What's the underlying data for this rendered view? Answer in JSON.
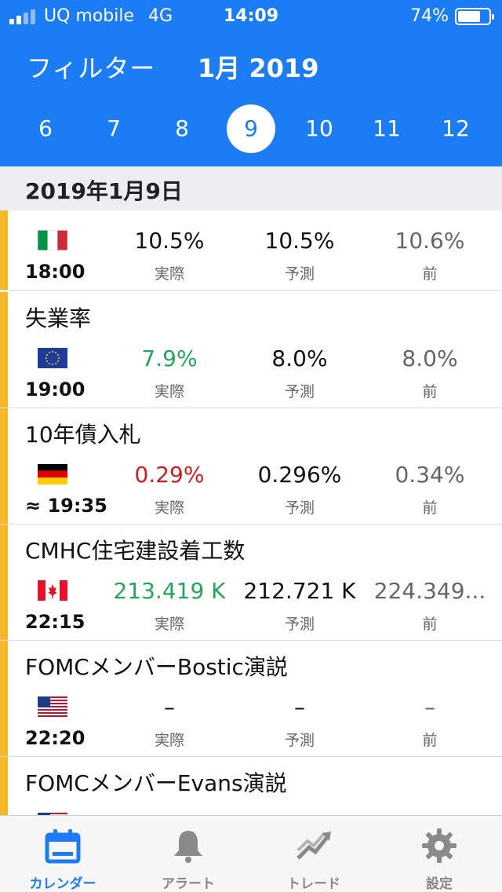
{
  "status_bar": {
    "carrier": "UQ mobile",
    "network": "4G",
    "time": "14:09",
    "battery": "74%",
    "battery_fraction": 0.74
  },
  "header": {
    "filter_label": "フィルター",
    "month_title": "1月 2019",
    "days": [
      "6",
      "7",
      "8",
      "9",
      "10",
      "11",
      "12"
    ],
    "selected_day": "9"
  },
  "date_header": "2019年1月9日",
  "labels": {
    "actual": "実際",
    "forecast": "予測",
    "previous": "前"
  },
  "events": [
    {
      "title": "",
      "flag": "italy-flag",
      "time": "18:00",
      "actual": "10.5%",
      "actual_color": "#111111",
      "forecast": "10.5%",
      "previous": "10.6%"
    },
    {
      "title": "失業率",
      "flag": "eu-flag",
      "time": "19:00",
      "actual": "7.9%",
      "actual_color": "#27a35b",
      "forecast": "8.0%",
      "previous": "8.0%"
    },
    {
      "title": "10年債入札",
      "flag": "germany-flag",
      "time": "≈ 19:35",
      "actual": "0.29%",
      "actual_color": "#cc1f1f",
      "forecast": "0.296%",
      "previous": "0.34%"
    },
    {
      "title": "CMHC住宅建設着工数",
      "flag": "canada-flag",
      "time": "22:15",
      "actual": "213.419 K",
      "actual_color": "#27a35b",
      "forecast": "212.721 K",
      "previous": "224.349..."
    },
    {
      "title": "FOMCメンバーBostic演説",
      "flag": "usa-flag",
      "time": "22:20",
      "actual": "–",
      "actual_color": "#111111",
      "forecast": "–",
      "previous": "–"
    },
    {
      "title": "FOMCメンバーEvans演説",
      "flag": "usa-flag",
      "time": "",
      "actual": "",
      "actual_color": "#111111",
      "forecast": "",
      "previous": ""
    }
  ],
  "accent_color": "#1b7cf3",
  "event_bar_color": "#f5b82b",
  "tabs": [
    {
      "label": "カレンダー",
      "icon": "calendar-icon",
      "active": true
    },
    {
      "label": "アラート",
      "icon": "bell-icon",
      "active": false
    },
    {
      "label": "トレード",
      "icon": "trend-icon",
      "active": false
    },
    {
      "label": "設定",
      "icon": "gear-icon",
      "active": false
    }
  ]
}
